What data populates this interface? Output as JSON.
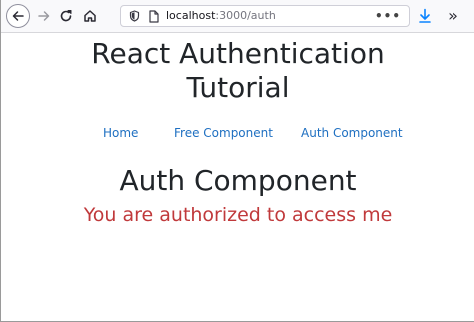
{
  "browser": {
    "url_host": "localhost",
    "url_path": ":3000/auth",
    "more_label": "•••",
    "overflow_label": "»",
    "icons": [
      "back-arrow-icon",
      "forward-arrow-icon",
      "reload-icon",
      "home-icon",
      "shield-icon",
      "page-icon",
      "download-icon"
    ]
  },
  "page": {
    "title": "React Authentication Tutorial",
    "nav": {
      "home": "Home",
      "free": "Free Component",
      "auth": "Auth Component"
    },
    "heading": "Auth Component",
    "message": "You are authorized to access me"
  },
  "colors": {
    "link": "#1e6fc1",
    "message": "#c0393b",
    "text": "#212529"
  }
}
